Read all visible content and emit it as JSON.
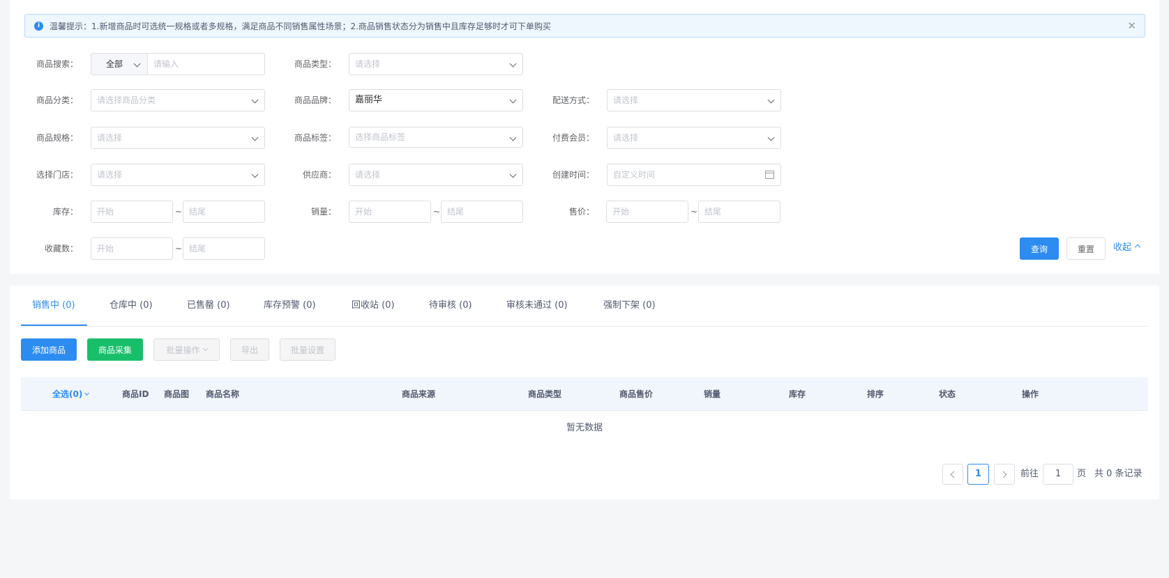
{
  "alert": {
    "text": "温馨提示：1.新增商品时可选统一规格或者多规格，满足商品不同销售属性场景；2.商品销售状态分为销售中且库存足够时才可下单购买",
    "info_glyph": "i",
    "close_glyph": "✕"
  },
  "filters": {
    "search": {
      "label": "商品搜索：",
      "scope_value": "全部",
      "placeholder": "请输入"
    },
    "type": {
      "label": "商品类型：",
      "placeholder": "请选择"
    },
    "category": {
      "label": "商品分类：",
      "placeholder": "请选择商品分类"
    },
    "brand": {
      "label": "商品品牌：",
      "value": "嘉丽华"
    },
    "delivery": {
      "label": "配送方式：",
      "placeholder": "请选择"
    },
    "spec": {
      "label": "商品规格：",
      "placeholder": "请选择"
    },
    "tag": {
      "label": "商品标签：",
      "placeholder": "选择商品标签"
    },
    "member": {
      "label": "付费会员：",
      "placeholder": "请选择"
    },
    "store": {
      "label": "选择门店：",
      "placeholder": "请选择"
    },
    "supplier": {
      "label": "供应商：",
      "placeholder": "请选择"
    },
    "created": {
      "label": "创建时间：",
      "placeholder": "自定义时间"
    },
    "stock": {
      "label": "库存：",
      "start": "开始",
      "end": "结尾"
    },
    "sales": {
      "label": "销量：",
      "start": "开始",
      "end": "结尾"
    },
    "price": {
      "label": "售价：",
      "start": "开始",
      "end": "结尾"
    },
    "favorites": {
      "label": "收藏数：",
      "start": "开始",
      "end": "结尾"
    },
    "range_sep": "~"
  },
  "actions": {
    "query": "查询",
    "reset": "重置",
    "collapse": "收起"
  },
  "tabs": [
    {
      "label": "销售中 (0)"
    },
    {
      "label": "仓库中 (0)"
    },
    {
      "label": "已售罄 (0)"
    },
    {
      "label": "库存预警 (0)"
    },
    {
      "label": "回收站 (0)"
    },
    {
      "label": "待审核 (0)"
    },
    {
      "label": "审核未通过 (0)"
    },
    {
      "label": "强制下架 (0)"
    }
  ],
  "toolbar": {
    "add": "添加商品",
    "collect": "商品采集",
    "batch_ops": "批量操作",
    "export": "导出",
    "batch_settings": "批量设置"
  },
  "table": {
    "select_all": "全选(0)",
    "columns": [
      "商品ID",
      "商品图",
      "商品名称",
      "商品来源",
      "商品类型",
      "商品售价",
      "销量",
      "库存",
      "排序",
      "状态",
      "操作"
    ],
    "empty": "暂无数据"
  },
  "pagination": {
    "current": "1",
    "goto_prefix": "前往",
    "goto_value": "1",
    "goto_suffix": "页",
    "total": "共 0 条记录"
  },
  "colors": {
    "primary": "#2d8cf0",
    "success": "#19be6b",
    "alert_bg": "#eef6fe"
  }
}
